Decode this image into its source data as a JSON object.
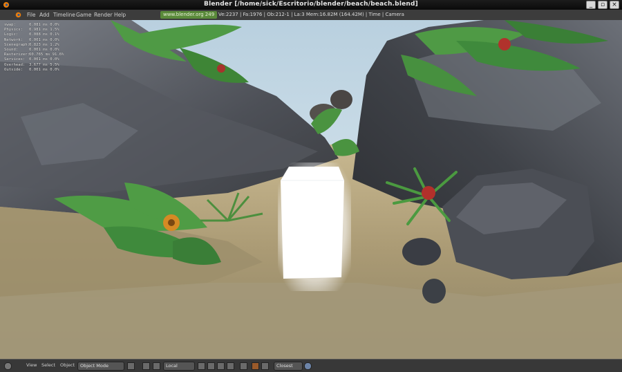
{
  "window": {
    "title": "Blender [/home/sick/Escritorio/blender/beach/beach.blend]",
    "controls": [
      "_",
      "▫",
      "×"
    ]
  },
  "menu": {
    "items": [
      "File",
      "Add",
      "Timeline",
      "Game",
      "Render",
      "Help"
    ],
    "url": "www.blender.org 249",
    "stats": "Ve:2237 | Fa:1976 | Ob:212-1 | La:3   Mem:16.82M (164.42M) | Time | Camera"
  },
  "debug_overlay": [
    {
      "label": "swap:",
      "value": "0.081 ms 0.0%"
    },
    {
      "label": "Physics:",
      "value": "0.981 ms 1.5%"
    },
    {
      "label": "Logic:",
      "value": "0.088 ms 0.1%"
    },
    {
      "label": "Network:",
      "value": "0.001 ms 0.0%"
    },
    {
      "label": "Scenegraph:",
      "value": "0.823 ms 1.2%"
    },
    {
      "label": "Sound:",
      "value": "0.001 ms 0.0%"
    },
    {
      "label": "Rasterizer:",
      "value": "60.765 ms 91.6%"
    },
    {
      "label": "Services:",
      "value": "0.001 ms 0.0%"
    },
    {
      "label": "Overhead:",
      "value": "3.677 ms 5.5%"
    },
    {
      "label": "Outside:",
      "value": "0.001 ms 0.0%"
    }
  ],
  "bottom": {
    "view": "View",
    "select": "Select",
    "object": "Object",
    "mode": "Object Mode",
    "pivot": "Local",
    "snap": "Closest"
  },
  "colors": {
    "sky": "#c9dbe6",
    "sand": "#b3a37c",
    "rock": "#5e6167",
    "foliage": "#3f8a3c",
    "block": "#ffffff"
  }
}
